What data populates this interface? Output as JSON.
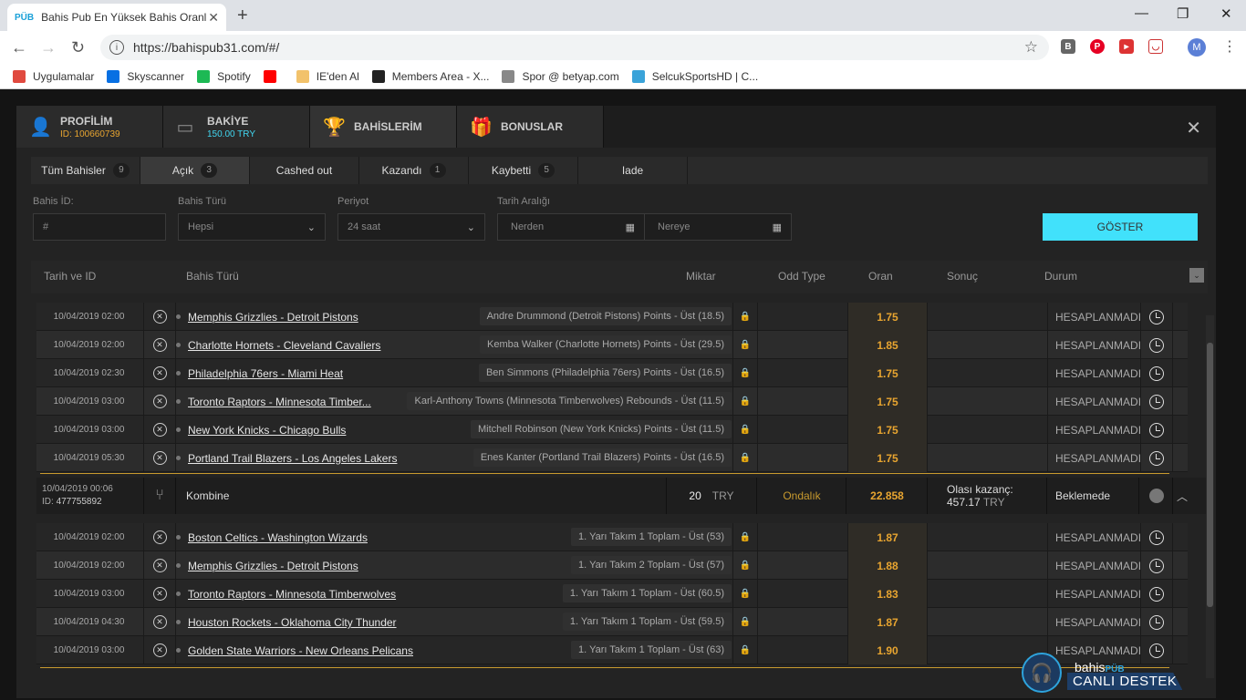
{
  "browser": {
    "tab_title": "Bahis Pub En Yüksek Bahis Oranl",
    "tab_favicon": "PÜB",
    "url": "https://bahispub31.com/#/",
    "avatar_letter": "M",
    "ext_letter": "B"
  },
  "bookmarks": [
    {
      "label": "Uygulamalar",
      "color": "#e04a3f"
    },
    {
      "label": "Skyscanner",
      "color": "#0770e3"
    },
    {
      "label": "Spotify",
      "color": "#1db954"
    },
    {
      "label": "",
      "color": "#ff0000"
    },
    {
      "label": "IE'den Al",
      "color": "#f2c26b"
    },
    {
      "label": "Members Area - X...",
      "color": "#222222"
    },
    {
      "label": "Spor @ betyap.com",
      "color": "#888888"
    },
    {
      "label": "SelcukSportsHD | C...",
      "color": "#3aa3d9"
    }
  ],
  "main_tabs": [
    {
      "title": "PROFİLİM",
      "sub": "ID: 100660739",
      "sub_color": "#e8a530"
    },
    {
      "title": "BAKİYE",
      "sub": "150.00 TRY",
      "sub_color": "#41d6f0"
    },
    {
      "title": "BAHİSLERİM",
      "sub": "",
      "sub_color": "#ffffff"
    },
    {
      "title": "BONUSLAR",
      "sub": "",
      "sub_color": "#ffffff"
    }
  ],
  "sub_tabs": [
    {
      "label": "Tüm Bahisler",
      "count": "9"
    },
    {
      "label": "Açık",
      "count": "3"
    },
    {
      "label": "Cashed out",
      "count": ""
    },
    {
      "label": "Kazandı",
      "count": "1"
    },
    {
      "label": "Kaybetti",
      "count": "5"
    },
    {
      "label": "Iade",
      "count": ""
    }
  ],
  "filters": {
    "id_label": "Bahis İD:",
    "id_placeholder": "#",
    "type_label": "Bahis Türü",
    "type_value": "Hepsi",
    "period_label": "Periyot",
    "period_value": "24 saat",
    "range_label": "Tarih Aralığı",
    "from_placeholder": "Nerden",
    "to_placeholder": "Nereye",
    "show_button": "GÖSTER"
  },
  "table_header": {
    "date": "Tarih ve ID",
    "type": "Bahis Türü",
    "amount": "Miktar",
    "odd_type": "Odd Type",
    "odds": "Oran",
    "result": "Sonuç",
    "status": "Durum"
  },
  "group1": [
    {
      "date": "10/04/2019 02:00",
      "match": "Memphis Grizzlies - Detroit Pistons",
      "selection": "Andre Drummond (Detroit Pistons) Points - Üst (18.5)",
      "odds": "1.75",
      "status": "HESAPLANMADI"
    },
    {
      "date": "10/04/2019 02:00",
      "match": "Charlotte Hornets - Cleveland Cavaliers",
      "selection": "Kemba Walker (Charlotte Hornets) Points - Üst (29.5)",
      "odds": "1.85",
      "status": "HESAPLANMADI"
    },
    {
      "date": "10/04/2019 02:30",
      "match": "Philadelphia 76ers - Miami Heat",
      "selection": "Ben Simmons (Philadelphia 76ers) Points - Üst (16.5)",
      "odds": "1.75",
      "status": "HESAPLANMADI"
    },
    {
      "date": "10/04/2019 03:00",
      "match": "Toronto Raptors - Minnesota Timber...",
      "selection": "Karl-Anthony Towns (Minnesota Timberwolves) Rebounds - Üst (11.5)",
      "odds": "1.75",
      "status": "HESAPLANMADI"
    },
    {
      "date": "10/04/2019 03:00",
      "match": "New York Knicks - Chicago Bulls",
      "selection": "Mitchell Robinson (New York Knicks) Points - Üst (11.5)",
      "odds": "1.75",
      "status": "HESAPLANMADI"
    },
    {
      "date": "10/04/2019 05:30",
      "match": "Portland Trail Blazers - Los Angeles Lakers",
      "selection": "Enes Kanter (Portland Trail Blazers) Points - Üst (16.5)",
      "odds": "1.75",
      "status": "HESAPLANMADI"
    }
  ],
  "combo": {
    "date": "10/04/2019 00:06",
    "id_prefix": "ID:",
    "id": "477755892",
    "type": "Kombine",
    "amount": "20",
    "currency": "TRY",
    "odd_type": "Ondalık",
    "odds": "22.858",
    "potential_label": "Olası kazanç:",
    "potential": "457.17",
    "status": "Beklemede"
  },
  "group2": [
    {
      "date": "10/04/2019 02:00",
      "match": "Boston Celtics - Washington Wizards",
      "selection": "1. Yarı Takım 1 Toplam - Üst (53)",
      "odds": "1.87",
      "status": "HESAPLANMADI"
    },
    {
      "date": "10/04/2019 02:00",
      "match": "Memphis Grizzlies - Detroit Pistons",
      "selection": "1. Yarı Takım 2 Toplam - Üst (57)",
      "odds": "1.88",
      "status": "HESAPLANMADI"
    },
    {
      "date": "10/04/2019 03:00",
      "match": "Toronto Raptors - Minnesota Timberwolves",
      "selection": "1. Yarı Takım 1 Toplam - Üst (60.5)",
      "odds": "1.83",
      "status": "HESAPLANMADI"
    },
    {
      "date": "10/04/2019 04:30",
      "match": "Houston Rockets - Oklahoma City Thunder",
      "selection": "1. Yarı Takım 1 Toplam - Üst (59.5)",
      "odds": "1.87",
      "status": "HESAPLANMADI"
    },
    {
      "date": "10/04/2019 03:00",
      "match": "Golden State Warriors - New Orleans Pelicans",
      "selection": "1. Yarı Takım 1 Toplam - Üst (63)",
      "odds": "1.90",
      "status": "HESAPLANMADI"
    }
  ],
  "support": {
    "brand": "bahis",
    "brand_suffix": "PÜB",
    "label": "CANLI DESTEK"
  }
}
